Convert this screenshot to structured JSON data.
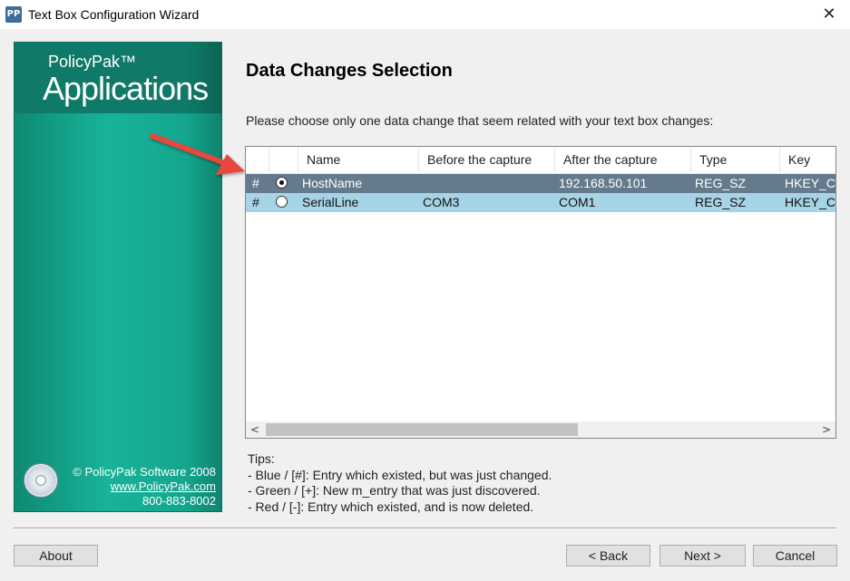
{
  "window": {
    "title": "Text Box Configuration Wizard",
    "icon_label": "PP",
    "close_glyph": "✕"
  },
  "banner": {
    "brand_small": "PolicyPak™",
    "brand_big": "Applications",
    "copyright": "© PolicyPak Software 2008",
    "website": "www.PolicyPak.com",
    "phone": "800-883-8002"
  },
  "page": {
    "title": "Data Changes Selection",
    "instruction": "Please choose only one data change that seem related with your text box changes:"
  },
  "table": {
    "columns": [
      "",
      "",
      "Name",
      "Before the capture",
      "After the capture",
      "Type",
      "Key"
    ],
    "rows": [
      {
        "marker": "#",
        "selected": true,
        "name": "HostName",
        "before": "",
        "after": "192.168.50.101",
        "type": "REG_SZ",
        "key": "HKEY_C"
      },
      {
        "marker": "#",
        "selected": false,
        "name": "SerialLine",
        "before": "COM3",
        "after": "COM1",
        "type": "REG_SZ",
        "key": "HKEY_C"
      }
    ],
    "scroll_left": "<",
    "scroll_right": ">"
  },
  "tips": {
    "heading": "Tips:",
    "lines": [
      "- Blue / [#]: Entry which existed, but was just changed.",
      "- Green / [+]: New m_entry that was just discovered.",
      "- Red / [-]: Entry which existed, and is now deleted."
    ]
  },
  "buttons": {
    "about": "About",
    "back": "< Back",
    "next": "Next >",
    "cancel": "Cancel"
  },
  "colors": {
    "selected_row": "#657a8c",
    "alt_row": "#a7d3e6",
    "banner": "#18b39a",
    "arrow": "#e8463c"
  }
}
